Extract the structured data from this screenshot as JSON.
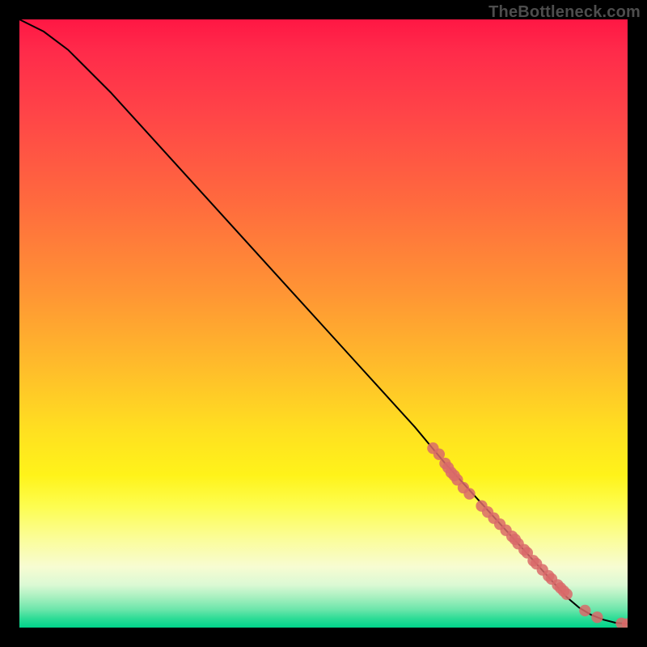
{
  "attribution": "TheBottleneck.com",
  "chart_data": {
    "type": "line",
    "title": "",
    "xlabel": "",
    "ylabel": "",
    "xlim": [
      0,
      100
    ],
    "ylim": [
      0,
      100
    ],
    "series": [
      {
        "name": "curve",
        "x": [
          0,
          2,
          4,
          6,
          8,
          10,
          15,
          20,
          25,
          30,
          35,
          40,
          45,
          50,
          55,
          60,
          65,
          70,
          75,
          80,
          85,
          90,
          92,
          94,
          96,
          98,
          100
        ],
        "y": [
          100,
          99,
          98,
          96.5,
          95,
          93,
          88,
          82.5,
          77,
          71.5,
          66,
          60.5,
          55,
          49.5,
          44,
          38.5,
          33,
          27,
          21.5,
          16,
          10.5,
          5,
          3.3,
          2.1,
          1.3,
          0.8,
          0.6
        ]
      }
    ],
    "points": {
      "name": "markers",
      "x": [
        68,
        69,
        70,
        70.5,
        71,
        71.5,
        72,
        73,
        74,
        76,
        77,
        78,
        79,
        80,
        81,
        81.5,
        82,
        83,
        83.5,
        84.5,
        85,
        86,
        87,
        87.5,
        88.5,
        89,
        89.5,
        90,
        93,
        95,
        99,
        100
      ],
      "y": [
        29.5,
        28.5,
        27,
        26.3,
        25.5,
        25,
        24.3,
        23,
        22,
        20,
        19,
        18,
        17,
        16,
        15,
        14.5,
        13.8,
        12.8,
        12.3,
        11,
        10.5,
        9.5,
        8.5,
        8,
        7,
        6.5,
        6,
        5.5,
        2.8,
        1.7,
        0.7,
        0.6
      ]
    },
    "gradient_stops": [
      {
        "pos": 0.0,
        "color": "#ff1744"
      },
      {
        "pos": 0.3,
        "color": "#ff6a3e"
      },
      {
        "pos": 0.58,
        "color": "#ffbf2a"
      },
      {
        "pos": 0.75,
        "color": "#fff31a"
      },
      {
        "pos": 0.9,
        "color": "#f7fcd2"
      },
      {
        "pos": 1.0,
        "color": "#00d38a"
      }
    ]
  }
}
